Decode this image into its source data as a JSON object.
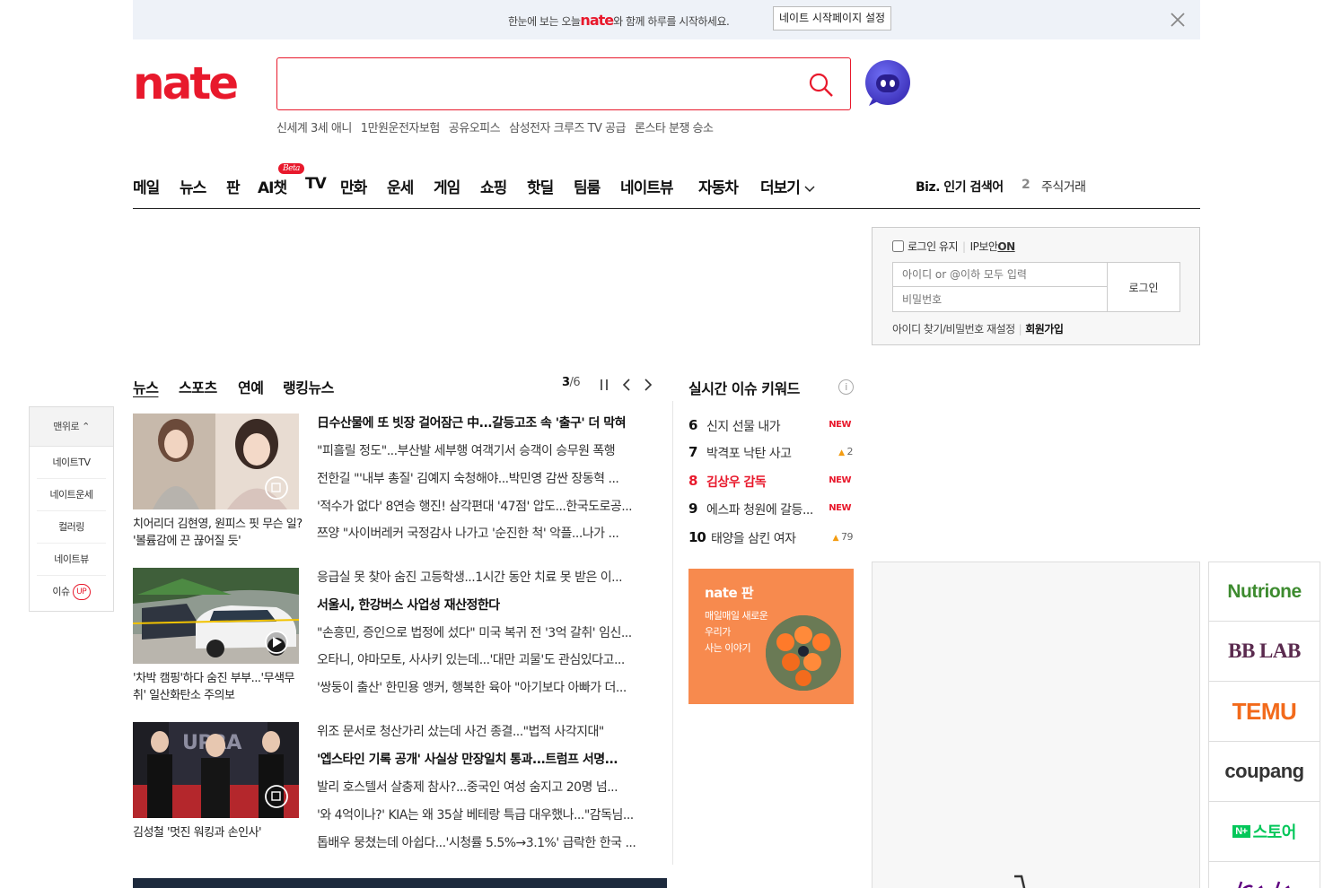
{
  "banner": {
    "text_pre": "한눈에 보는 오늘",
    "brand": "nate",
    "text_post": "와 함께 하루를 시작하세요.",
    "button": "네이트 시작페이지 설정"
  },
  "trending": [
    "신세계 3세 애니",
    "1만원운전자보험",
    "공유오피스",
    "삼성전자 크루즈 TV 공급",
    "론스타 분쟁 승소"
  ],
  "nav": {
    "items": [
      "메일",
      "뉴스",
      "판",
      "AI챗",
      "TV",
      "만화",
      "운세",
      "게임",
      "쇼핑",
      "핫딜",
      "팀룸",
      "네이트뷰",
      "자동차",
      "더보기"
    ],
    "beta": "Beta",
    "biz_label": "Biz. 인기 검색어",
    "biz_rank": "2",
    "biz_keyword": "주식거래"
  },
  "login": {
    "keep_label": "로그인 유지",
    "ip_label": "IP보안",
    "ip_state": "ON",
    "id_placeholder": "아이디 or @이하 모두 입력",
    "pw_placeholder": "비밀번호",
    "button": "로그인",
    "find": "아이디 찾기/비밀번호 재설정",
    "signup": "회원가입"
  },
  "side_nav": {
    "top": "맨위로",
    "items": [
      "네이트TV",
      "네이트운세",
      "컬러링"
    ],
    "view": "네이트뷰",
    "issue": "이슈",
    "issue_badge": "UP"
  },
  "news": {
    "tabs": [
      "뉴스",
      "스포츠",
      "연예",
      "랭킹뉴스"
    ],
    "pager_current": "3",
    "pager_total": "/6",
    "blocks": [
      {
        "caption": "치어리더 김현영, 원피스 핏 무슨 일? '볼륨감에 끈 끊어질 듯'",
        "headlines": [
          "日수산물에 또 빗장 걸어잠근 中...갈등고조 속 '출구' 더 막혀",
          "\"피흘릴 정도\"...부산발 세부행 여객기서 승객이 승무원 폭행",
          "전한길 \"'내부 총질' 김예지 숙청해야...박민영 감싼 장동혁 ...",
          "'적수가 없다' 8연승 행진! 삼각편대 '47점' 압도...한국도로공...",
          "쯔양 \"사이버레커 국정감사 나가고 '순진한 척' 악플...나가 ..."
        ]
      },
      {
        "caption": "'차박 캠핑'하다 숨진 부부...'무색무취' 일산화탄소 주의보",
        "headlines": [
          "응급실 못 찾아 숨진 고등학생...1시간 동안 치료 못 받은 이...",
          "서울시, 한강버스 사업성 재산정한다",
          "\"손흥민, 증인으로 법정에 섰다\" 미국 복귀 전 '3억 갈취' 임신...",
          "오타니, 야마모토, 사사키 있는데...'대만 괴물'도 관심있다고...",
          "'쌍둥이 출산' 한민용 앵커, 행복한 육아 \"아기보다 아빠가 더..."
        ]
      },
      {
        "caption": "김성철 '멋진 워킹과 손인사'",
        "headlines": [
          "위조 문서로 청산가리 샀는데 사건 종결...\"법적 사각지대\"",
          "'엡스타인 기록 공개' 사실상 만장일치 통과...트럼프 서명...",
          "발리 호스텔서 살충제 참사?...중국인 여성 숨지고 20명 넘...",
          "'와 4억이나?' KIA는 왜 35살 베테랑 특급 대우했나...\"감독님...",
          "톱배우 뭉쳤는데 아쉽다...'시청률 5.5%→3.1%' 급락한 한국 ..."
        ]
      }
    ]
  },
  "realtime": {
    "title": "실시간 이슈 키워드",
    "info": "i",
    "rows": [
      {
        "rank": "6",
        "text": "신지 선물 내가",
        "badge": "NEW",
        "move": ""
      },
      {
        "rank": "7",
        "text": "박격포 낙탄 사고",
        "badge": "",
        "move": "2"
      },
      {
        "rank": "8",
        "text": "김상우 감독",
        "badge": "NEW",
        "move": ""
      },
      {
        "rank": "9",
        "text": "에스파 청원에 갈등...",
        "badge": "NEW",
        "move": ""
      },
      {
        "rank": "10",
        "text": "태양을 삼킨 여자",
        "badge": "",
        "move": "79"
      }
    ]
  },
  "pann": {
    "brand": "nate 판",
    "line1": "매일매일 새로운",
    "line2": "우리가",
    "line3": "사는 이야기"
  },
  "shops": [
    {
      "name": "Nutrione",
      "color": "#3d8b2f"
    },
    {
      "name": "BB LAB",
      "color": "#5a2a4e"
    },
    {
      "name": "TEMU",
      "color": "#f26a1b"
    },
    {
      "name": "coupang",
      "color": "#333333"
    },
    {
      "name": "스토어",
      "color": "#03c75a"
    }
  ],
  "colors": {
    "brand_red": "#e8192c"
  }
}
